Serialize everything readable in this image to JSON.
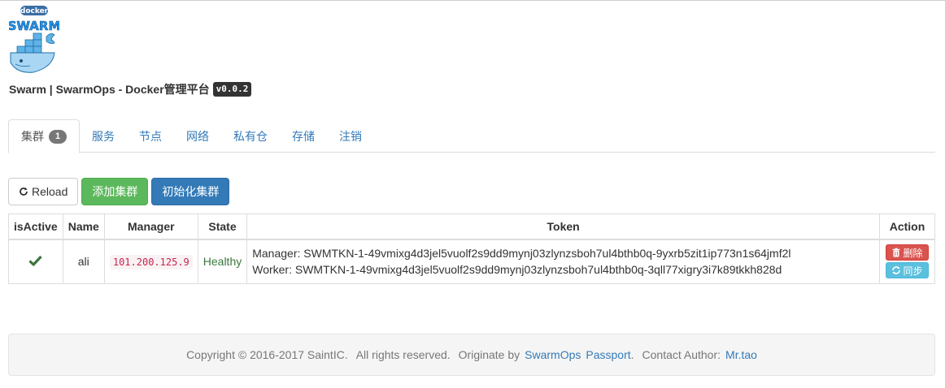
{
  "logo": {
    "label_top": "docker",
    "label_main": "SWARM"
  },
  "header": {
    "title": "Swarm | SwarmOps - Docker管理平台",
    "version": "v0.0.2"
  },
  "tabs": [
    {
      "label": "集群",
      "badge": "1",
      "active": true
    },
    {
      "label": "服务"
    },
    {
      "label": "节点"
    },
    {
      "label": "网络"
    },
    {
      "label": "私有仓"
    },
    {
      "label": "存储"
    },
    {
      "label": "注销"
    }
  ],
  "toolbar": {
    "reload_label": "Reload",
    "add_label": "添加集群",
    "init_label": "初始化集群"
  },
  "table": {
    "columns": [
      "isActive",
      "Name",
      "Manager",
      "State",
      "Token",
      "Action"
    ],
    "rows": [
      {
        "name": "ali",
        "manager": "101.200.125.9",
        "state": "Healthy",
        "token_manager": "Manager: SWMTKN-1-49vmixg4d3jel5vuolf2s9dd9mynj03zlynzsboh7ul4bthb0q-9yxrb5zit1ip773n1s64jmf2l",
        "token_worker": "Worker: SWMTKN-1-49vmixg4d3jel5vuolf2s9dd9mynj03zlynzsboh7ul4bthb0q-3qll77xigry3i7k89tkkh828d",
        "delete_label": "删除",
        "sync_label": "同步"
      }
    ]
  },
  "footer": {
    "copyright": "Copyright © 2016-2017 SaintIC.",
    "rights": "All rights reserved.",
    "originate": "Originate by",
    "link_swarmops": "SwarmOps",
    "link_passport": "Passport",
    "period": ".",
    "contact": "Contact Author:",
    "link_author": "Mr.tao"
  },
  "colors": {
    "link": "#337ab7",
    "success": "#5cb85c",
    "primary": "#337ab7",
    "danger": "#d9534f",
    "info": "#5bc0de",
    "healthy": "#3c763d"
  }
}
